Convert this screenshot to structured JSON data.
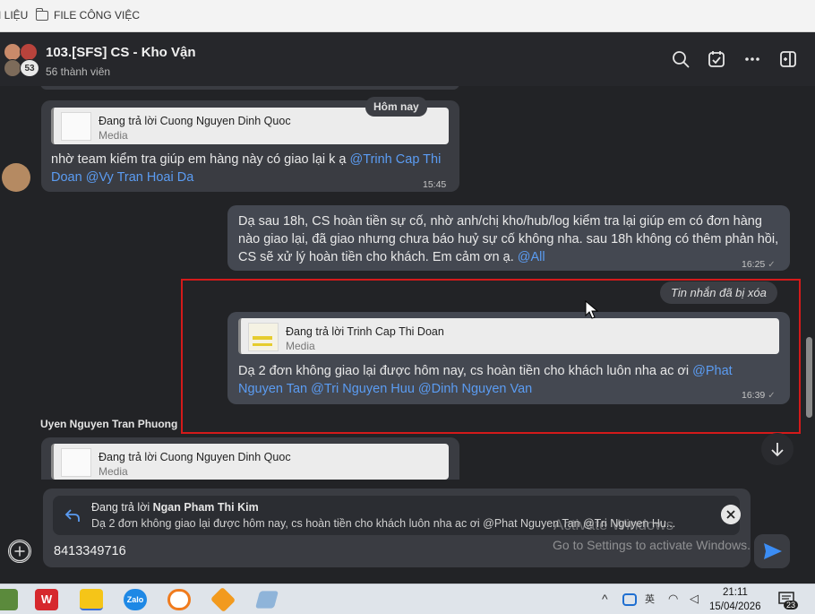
{
  "bookmarks": {
    "item1": "I LIỆU",
    "item2": "FILE CÔNG VIỆC"
  },
  "header": {
    "title": "103.[SFS] CS - Kho Vận",
    "members": "56 thành viên",
    "avatar_count": "53"
  },
  "chat": {
    "date_label": "Hôm nay",
    "msg1": {
      "reply_title": "Đang trả lời Cuong Nguyen Dinh Quoc",
      "reply_sub": "Media",
      "text": "nhờ team kiểm tra giúp em hàng này có giao lại k ạ ",
      "mention1": "@Trinh Cap Thi Doan",
      "mention2": "@Vy Tran Hoai Da",
      "time": "15:45"
    },
    "msg2": {
      "text": "Dạ sau 18h, CS hoàn tiền sự cố, nhờ anh/chị kho/hub/log kiểm tra lại giúp em có đơn hàng nào giao lại, đã giao nhưng chưa báo huỷ sự cố không nha. sau 18h không có thêm phản hồi, CS sẽ xử lý hoàn tiền cho khách. Em cảm ơn ạ. ",
      "mention": "@All",
      "time": "16:25"
    },
    "deleted_label": "Tin nhắn đã bị xóa",
    "msg3": {
      "reply_title": "Đang trả lời Trinh Cap Thi Doan",
      "reply_sub": "Media",
      "text": "Dạ 2 đơn không giao lại được hôm nay, cs hoàn tiền cho khách luôn nha ac ơi ",
      "mention1": "@Phat Nguyen Tan",
      "mention2": "@Tri Nguyen Huu",
      "mention3": "@Dinh Nguyen Van",
      "time": "16:39"
    },
    "sender4": "Uyen Nguyen Tran Phuong",
    "msg4": {
      "reply_title": "Đang trả lời Cuong Nguyen Dinh Quoc",
      "reply_sub": "Media"
    }
  },
  "composer": {
    "quote_prefix": "Đang trả lời ",
    "quote_name": "Ngan Pham Thi Kim",
    "quote_text": "Dạ 2 đơn không giao lại được hôm nay, cs hoàn tiền cho khách luôn nha ac ơi @Phat Nguyen Tan @Tri Nguyen Hu...",
    "input_value": "8413349716"
  },
  "watermark": {
    "line1": "Activate Windows",
    "line2": "Go to Settings to activate Windows."
  },
  "taskbar": {
    "time": "21:11",
    "date": "15/04/2026",
    "notifications": "23"
  },
  "colors": {
    "mention": "#5b9cf2",
    "highlight_frame": "#d41a1a",
    "send": "#3b8df5"
  }
}
